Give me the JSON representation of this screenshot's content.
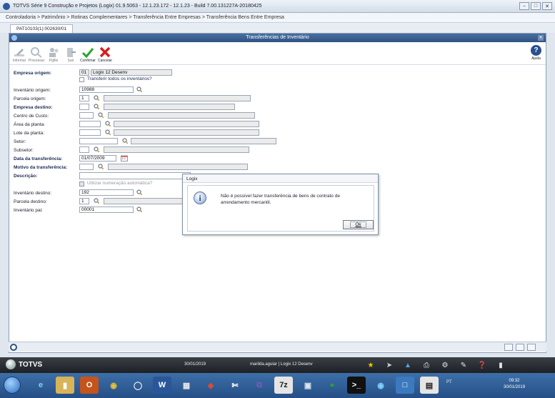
{
  "window": {
    "title": "TOTVS Série 9 Construção e Projetos (Logix) 01.9.5063 - 12.1.23.172 - 12.1.23 - Build 7.00.131227A-20180425"
  },
  "breadcrumb": "Controladoria > Patrimônio > Rotinas Complementares > Transferência Entre Empresas > Transferência Bens Entre Empresa",
  "tab": "PAT10103(1):002630/01",
  "frame_title": "Transferências de Inventário",
  "toolbar": {
    "informar": "Informar",
    "processar": "Processar",
    "pgfile": "Pgfile",
    "sair": "Sair",
    "confirmar": "Confirmar",
    "cancelar": "Cancelar",
    "ajuda": "Ajuda"
  },
  "form": {
    "empresa_origem": {
      "label": "Empresa origem:",
      "code": "01",
      "name": "Logix 12 Desenv"
    },
    "transferir_todos": "Transferir todos os inventários?",
    "inventario_origem": {
      "label": "Inventário origem:",
      "value": "10988"
    },
    "parcela_origem": {
      "label": "Parcela origem:",
      "value": "1"
    },
    "empresa_destino": {
      "label": "Empresa destino:"
    },
    "centro_custo": {
      "label": "Centro de Custo:"
    },
    "area_planta": {
      "label": "Área da planta:"
    },
    "lote_planta": {
      "label": "Lote da planta:"
    },
    "setor": {
      "label": "Setor:"
    },
    "subsetor": {
      "label": "Subsetor:"
    },
    "data_transferencia": {
      "label": "Data da transferência:",
      "value": "01/07/2009"
    },
    "motivo_transferencia": {
      "label": "Motivo da transferência:"
    },
    "descricao": {
      "label": "Descrição:"
    },
    "numeracao_auto": "Utilizar numeração automática?",
    "inventario_destino": {
      "label": "Inventário destino:",
      "value": "192"
    },
    "parcela_destino": {
      "label": "Parcela destino:",
      "value": "1"
    },
    "inventario_pai": {
      "label": "Inventário pai:",
      "value": "00001"
    }
  },
  "dialog": {
    "title": "Logix",
    "message": "Não é possível fazer transferência de bens de contrato de arrendamento mercantil.",
    "ok": "Ok"
  },
  "totvsbar": {
    "brand": "TOTVS",
    "date": "30/01/2019",
    "user": "marilda.aguiar | Logix 12 Desenv"
  },
  "taskbar": {
    "lang": "PT",
    "time": "09:32",
    "date": "30/01/2019"
  }
}
